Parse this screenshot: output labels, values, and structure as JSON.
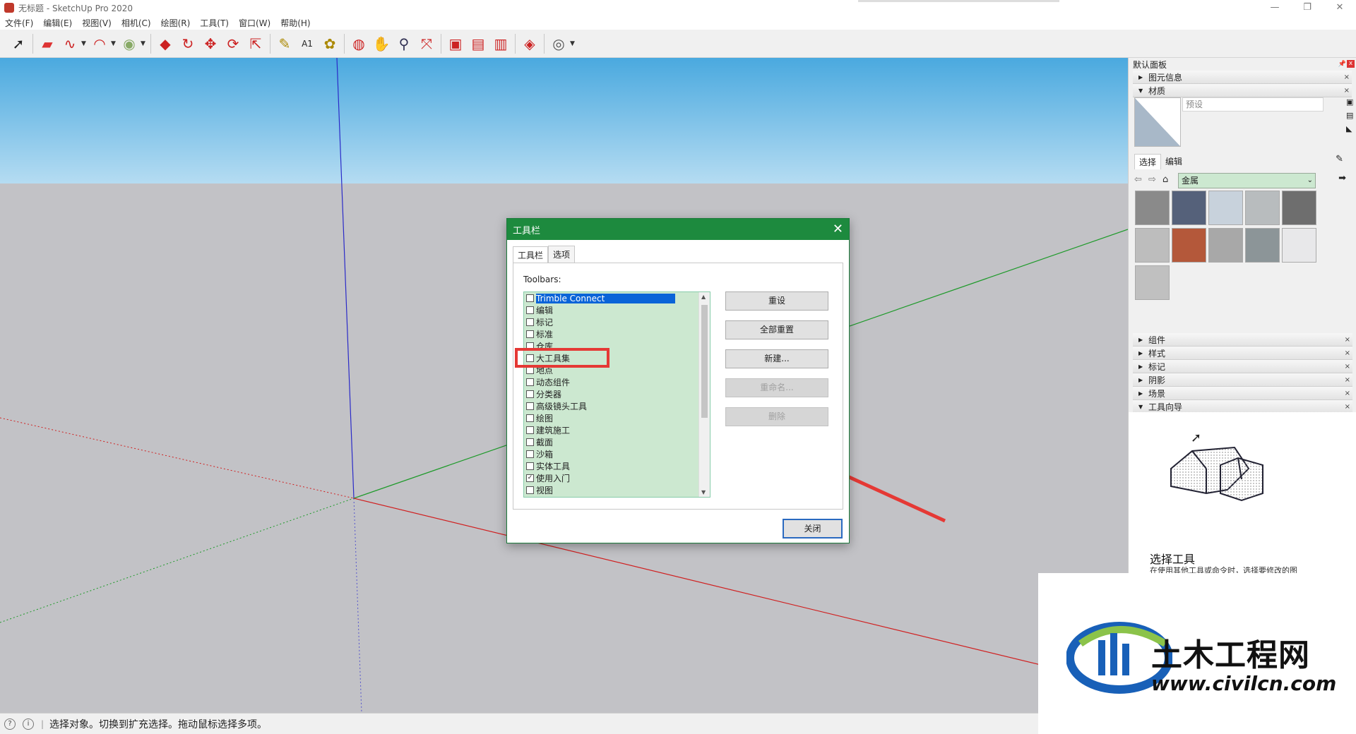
{
  "window": {
    "title": "无标题 - SketchUp Pro 2020"
  },
  "menu": [
    "文件(F)",
    "编辑(E)",
    "视图(V)",
    "相机(C)",
    "绘图(R)",
    "工具(T)",
    "窗口(W)",
    "帮助(H)"
  ],
  "toolbar": {
    "icons": [
      "select-icon",
      "eraser-icon",
      "freehand-icon",
      "arc-icon",
      "paint-icon",
      "pushpull-icon",
      "followme-icon",
      "move-icon",
      "rotate-icon",
      "scale-icon",
      "tape-measure-icon",
      "text-icon",
      "paint-bucket-icon",
      "orbit-icon",
      "pan-icon",
      "zoom-icon",
      "zoom-extents-icon",
      "warehouse-icon",
      "extension-warehouse-icon",
      "layout-icon",
      "ruby-icon",
      "account-icon"
    ]
  },
  "status": {
    "text": "选择对象。切换到扩充选择。拖动鼠标选择多项。"
  },
  "dialog": {
    "title": "工具栏",
    "tabs": [
      "工具栏",
      "选项"
    ],
    "toolbars_label": "Toolbars:",
    "items": [
      {
        "label": "Trimble Connect",
        "checked": false,
        "selected": true
      },
      {
        "label": "编辑",
        "checked": false
      },
      {
        "label": "标记",
        "checked": false
      },
      {
        "label": "标准",
        "checked": false
      },
      {
        "label": "仓库",
        "checked": false
      },
      {
        "label": "大工具集",
        "checked": false
      },
      {
        "label": "地点",
        "checked": false
      },
      {
        "label": "动态组件",
        "checked": false
      },
      {
        "label": "分类器",
        "checked": false
      },
      {
        "label": "高级镜头工具",
        "checked": false
      },
      {
        "label": "绘图",
        "checked": false
      },
      {
        "label": "建筑施工",
        "checked": false
      },
      {
        "label": "截面",
        "checked": false
      },
      {
        "label": "沙箱",
        "checked": false
      },
      {
        "label": "实体工具",
        "checked": false
      },
      {
        "label": "使用入门",
        "checked": true
      },
      {
        "label": "视图",
        "checked": false
      }
    ],
    "buttons": {
      "reset": "重设",
      "reset_all": "全部重置",
      "new": "新建...",
      "rename": "重命名...",
      "delete": "删除",
      "close": "关闭"
    }
  },
  "panel": {
    "title": "默认面板",
    "entity_info": "图元信息",
    "materials": "材质",
    "material_name_placeholder": "预设",
    "tab_select": "选择",
    "tab_edit": "编辑",
    "library": "金属",
    "swatch_colors": [
      "#8a8a8a",
      "#55617a",
      "#c8d2dc",
      "#b8bcbe",
      "#6e6e6e",
      "#bdbdbd",
      "#b4583a",
      "#a8a8a8",
      "#8c9598",
      "#e8e8ea",
      "#c0c0c0"
    ],
    "sections": [
      "组件",
      "样式",
      "标记",
      "阴影",
      "场景",
      "工具向导"
    ],
    "instructor_title": "选择工具",
    "instructor_desc": "在使用其他工具或命令时，选择要修改的图"
  },
  "watermark": {
    "name": "土木工程网",
    "url": "www.civilcn.com"
  }
}
